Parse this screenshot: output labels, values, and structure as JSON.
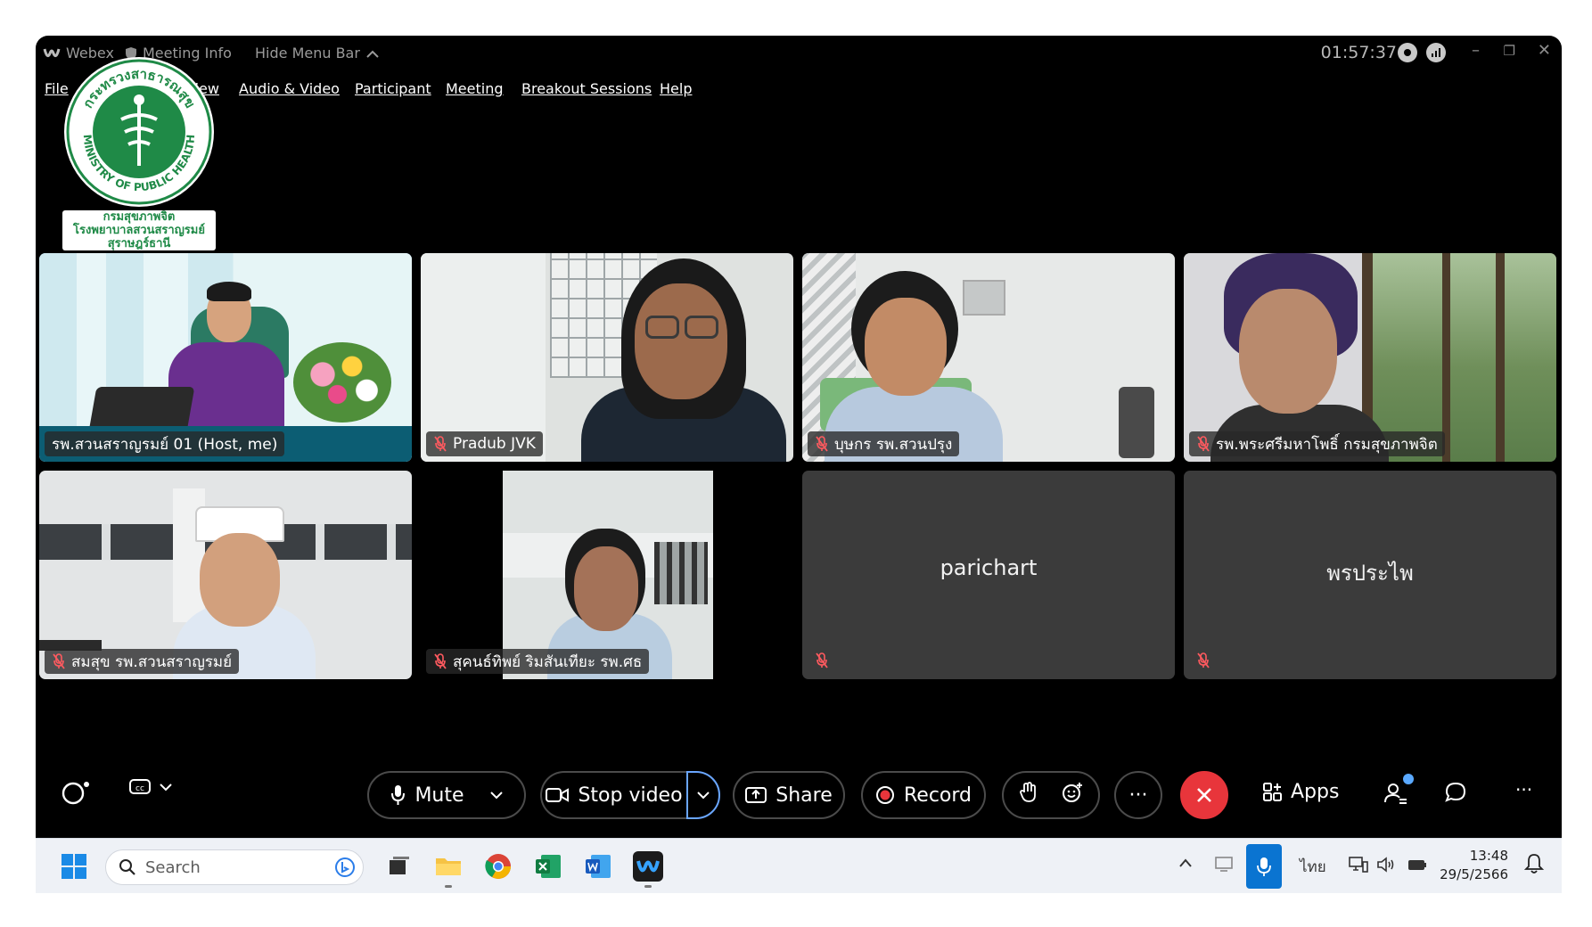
{
  "title_bar": {
    "app_name": "Webex",
    "meeting_info": "Meeting Info",
    "hide_menu_bar": "Hide Menu Bar",
    "timer": "01:57:37"
  },
  "menu": [
    "File",
    "View",
    "Audio & Video",
    "Participant",
    "Meeting",
    "Breakout Sessions",
    "Help"
  ],
  "logo": {
    "seal_text_top": "กระทรวงสาธารณสุข",
    "seal_text_bottom": "MINISTRY OF PUBLIC HEALTH",
    "line1": "กรมสุขภาพจิต",
    "line2": "โรงพยาบาลสวนสราญรมย์",
    "line3": "สุราษฎร์ธานี"
  },
  "participants": [
    {
      "name": "รพ.สวนสราญรมย์ 01 (Host, me)",
      "muted": false,
      "video": true,
      "active_speaker": true
    },
    {
      "name": "Pradub JVK",
      "muted": true,
      "video": true
    },
    {
      "name": "บุษกร รพ.สวนปรุง",
      "muted": true,
      "video": true
    },
    {
      "name": "รพ.พระศรีมหาโพธิ์ กรมสุขภาพจิต",
      "muted": true,
      "video": true
    },
    {
      "name": "สมสุข รพ.สวนสราญรมย์",
      "muted": true,
      "video": true
    },
    {
      "name": "สุคนธ์ทิพย์ ริมสันเทียะ รพ.ศธ",
      "muted": true,
      "video": true
    },
    {
      "name": "parichart",
      "muted": true,
      "video": false
    },
    {
      "name": "พรประไพ",
      "muted": true,
      "video": false
    }
  ],
  "controls": {
    "mute": "Mute",
    "stop_video": "Stop video",
    "share": "Share",
    "record": "Record",
    "more": "···",
    "apps": "Apps",
    "overflow": "···"
  },
  "taskbar": {
    "search_placeholder": "Search",
    "language": "ไทย",
    "time": "13:48",
    "date": "29/5/2566"
  },
  "colors": {
    "window_bg": "#000000",
    "active_border": "#7ec8ff",
    "end_call": "#e8353b",
    "muted_mic": "#ff5a5f",
    "taskbar_bg": "#eef1f6",
    "logo_green": "#1f8a47"
  }
}
